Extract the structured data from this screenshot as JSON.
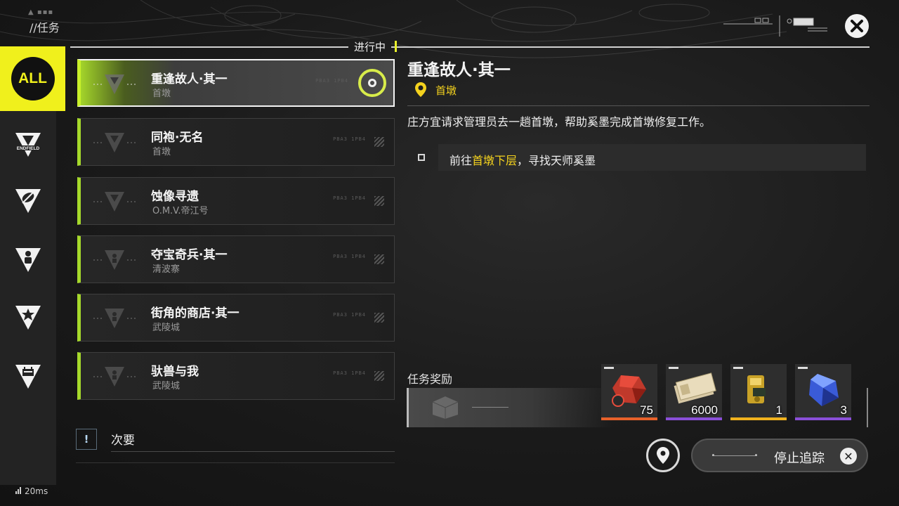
{
  "header": {
    "title": "//任务",
    "status_label": "进行中"
  },
  "sidebar": {
    "all_label": "ALL",
    "items": [
      {
        "icon": "endfield-icon",
        "label": "ENDFIELD"
      },
      {
        "icon": "leaf-icon"
      },
      {
        "icon": "person-icon"
      },
      {
        "icon": "star-icon"
      },
      {
        "icon": "calendar-icon"
      }
    ]
  },
  "quests": [
    {
      "name": "重逢故人·其一",
      "location": "首墩",
      "active": true
    },
    {
      "name": "同袍·无名",
      "location": "首墩"
    },
    {
      "name": "蚀像寻遗",
      "location": "O.M.V.帝江号"
    },
    {
      "name": "夺宝奇兵·其一",
      "location": "清波寨"
    },
    {
      "name": "街角的商店·其一",
      "location": "武陵城"
    },
    {
      "name": "驮兽与我",
      "location": "武陵城"
    }
  ],
  "secondary": {
    "label": "次要",
    "icon": "!"
  },
  "detail": {
    "title": "重逢故人·其一",
    "location": "首墩",
    "description": "庄方宜请求管理员去一趟首墩，帮助奚墨完成首墩修复工作。",
    "objective": {
      "prefix": "前往",
      "highlight": "首墩下层",
      "suffix": "，寻找天师奚墨"
    }
  },
  "rewards": {
    "label": "任务奖励",
    "items": [
      {
        "count": "75",
        "rarity_color": "#e8612a",
        "icon": "red-crystal-icon"
      },
      {
        "count": "6000",
        "rarity_color": "#8a4fd8",
        "icon": "banknote-icon"
      },
      {
        "count": "1",
        "rarity_color": "#f0b21e",
        "icon": "gold-device-icon"
      },
      {
        "count": "3",
        "rarity_color": "#8a4fd8",
        "icon": "blue-crystal-icon"
      }
    ]
  },
  "actions": {
    "stop_tracking": "停止追踪"
  },
  "footer": {
    "ping": "20ms"
  },
  "colors": {
    "accent": "#f0f01c",
    "quest_green": "#a6d92b",
    "highlight": "#f4d21e"
  }
}
